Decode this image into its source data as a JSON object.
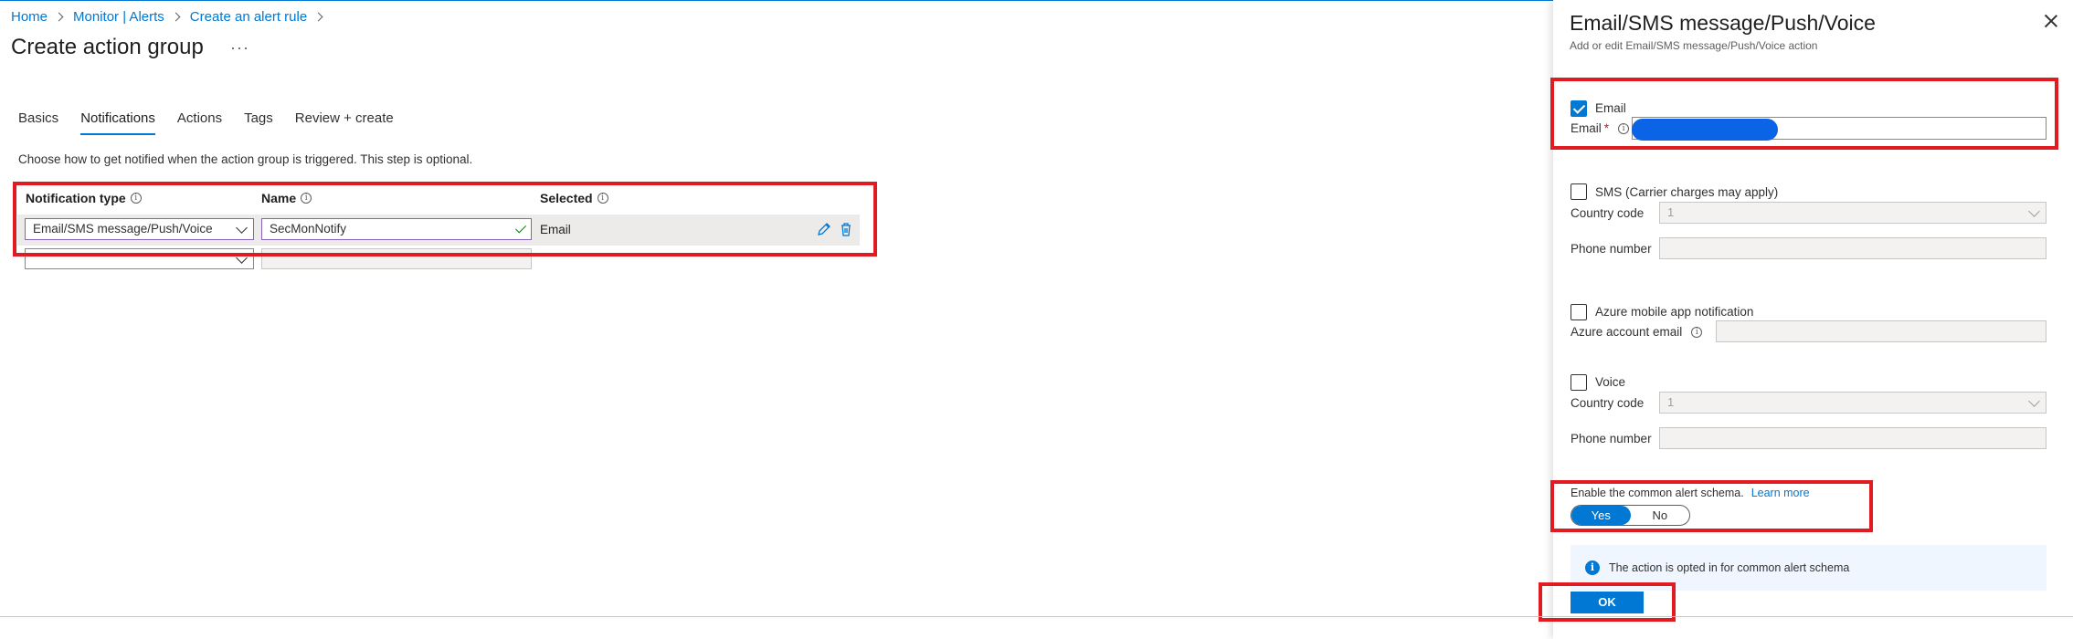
{
  "breadcrumb": [
    "Home",
    "Monitor | Alerts",
    "Create an alert rule"
  ],
  "page": {
    "title": "Create action group",
    "more": "···"
  },
  "tabs": [
    "Basics",
    "Notifications",
    "Actions",
    "Tags",
    "Review + create"
  ],
  "description": "Choose how to get notified when the action group is triggered. This step is optional.",
  "table": {
    "headers": [
      "Notification type",
      "Name",
      "Selected"
    ],
    "row": {
      "type": "Email/SMS message/Push/Voice",
      "name": "SecMonNotify",
      "selected": "Email"
    }
  },
  "panel": {
    "title": "Email/SMS message/Push/Voice",
    "subtitle": "Add or edit Email/SMS message/Push/Voice action",
    "email": {
      "checkbox_label": "Email",
      "field_label": "Email",
      "checked": true
    },
    "sms": {
      "checkbox_label": "SMS (Carrier charges may apply)",
      "country_label": "Country code",
      "country_value": "1",
      "phone_label": "Phone number"
    },
    "app": {
      "checkbox_label": "Azure mobile app notification",
      "account_label": "Azure account email"
    },
    "voice": {
      "checkbox_label": "Voice",
      "country_label": "Country code",
      "country_value": "1",
      "phone_label": "Phone number"
    },
    "schema": {
      "label": "Enable the common alert schema.",
      "learn_more": "Learn more",
      "yes": "Yes",
      "no": "No",
      "selected": "Yes"
    },
    "info": "The action is opted in for common alert schema",
    "ok": "OK"
  },
  "colors": {
    "accent": "#0078d4",
    "highlight": "#e01b22"
  }
}
